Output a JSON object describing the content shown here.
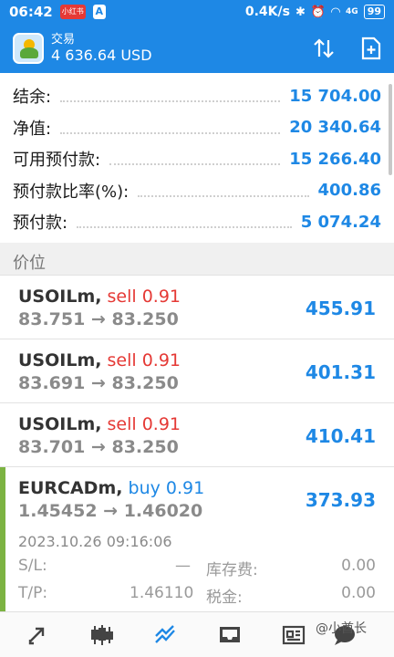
{
  "status_bar": {
    "time": "06:42",
    "badge1": "小红书",
    "badge2": "A",
    "speed": "0.4K/s",
    "net": "4G",
    "battery": "99"
  },
  "appbar": {
    "title": "交易",
    "balance": "4 636.64 USD"
  },
  "summary": [
    {
      "label": "结余:",
      "value": "15 704.00"
    },
    {
      "label": "净值:",
      "value": "20 340.64"
    },
    {
      "label": "可用预付款:",
      "value": "15 266.40"
    },
    {
      "label": "预付款比率(%):",
      "value": "400.86"
    },
    {
      "label": "预付款:",
      "value": "5 074.24"
    }
  ],
  "section_title": "价位",
  "positions": [
    {
      "symbol": "USOILm,",
      "side": "sell 0.91",
      "prices": "83.751 → 83.250",
      "profit": "455.91"
    },
    {
      "symbol": "USOILm,",
      "side": "sell 0.91",
      "prices": "83.691 → 83.250",
      "profit": "401.31"
    },
    {
      "symbol": "USOILm,",
      "side": "sell 0.91",
      "prices": "83.701 → 83.250",
      "profit": "410.41"
    },
    {
      "symbol": "EURCADm,",
      "side": "buy 0.91",
      "prices": "1.45452 → 1.46020",
      "profit": "373.93",
      "date": "2023.10.26 09:16:06",
      "sl_label": "S/L:",
      "sl_value": "—",
      "tp_label": "T/P:",
      "tp_value": "1.46110",
      "swap_label": "库存费:",
      "swap_value": "0.00",
      "tax_label": "税金:",
      "tax_value": "0.00"
    }
  ],
  "watermark": "@小酋长",
  "colors": {
    "accent": "#1e88e5",
    "sell": "#e53935",
    "buy_bar": "#7cb342"
  }
}
